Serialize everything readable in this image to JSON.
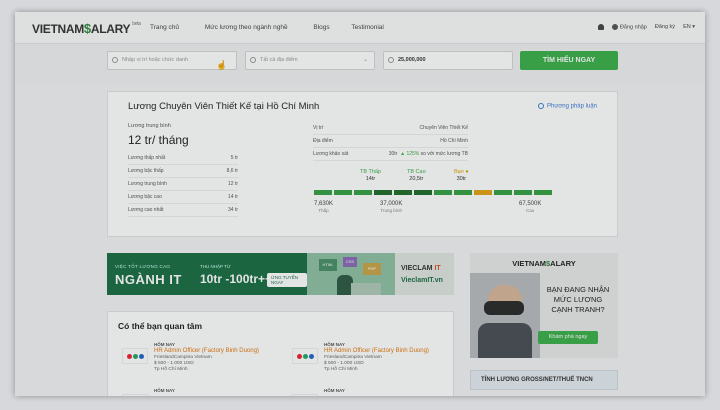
{
  "header": {
    "logo_main": "VIETNAM",
    "logo_dollar": "$",
    "logo_tail": "ALARY",
    "logo_beta": "beta",
    "nav": [
      "Trang chủ",
      "Mức lương theo ngành nghề",
      "Blogs",
      "Testimonial"
    ],
    "login": "Đăng nhập",
    "register": "Đăng ký",
    "lang": "EN ▾"
  },
  "search": {
    "position_placeholder": "Nhập vị trí hoặc chức danh",
    "location_placeholder": "Tất cả địa điểm",
    "salary_value": "25,000,000",
    "button": "TÌM HIỂU NGAY"
  },
  "result": {
    "title": "Lương Chuyên Viên Thiết Kế tại Hồ Chí Minh",
    "method_link": "Phương pháp luận",
    "avg_label": "Lương trung bình",
    "avg_value": "12 tr/ tháng",
    "stats": [
      {
        "label": "Lương thấp nhất",
        "value": "5 tr"
      },
      {
        "label": "Lương bậc thấp",
        "value": "8,6 tr"
      },
      {
        "label": "Lương trung bình",
        "value": "12 tr"
      },
      {
        "label": "Lương bậc cao",
        "value": "14 tr"
      },
      {
        "label": "Lương cao nhất",
        "value": "34 tr"
      }
    ],
    "info": [
      {
        "label": "Vị trí",
        "value": "Chuyên Viên Thiết Kế"
      },
      {
        "label": "Địa điểm",
        "value": "Hồ Chí Minh"
      }
    ],
    "survey_label": "Lương khảo sát",
    "survey_value": "30tr",
    "survey_pct": "▲ 125%",
    "survey_note": "so với mức lương TB",
    "gauge": {
      "low_label": "TB Thấp",
      "low_value": "14tr",
      "high_label": "TB Cao",
      "high_value": "20,5tr",
      "you_label": "Bạn ●",
      "you_value": "30tr",
      "you_level_percent": 73
    },
    "scale": [
      {
        "value": "7,630K",
        "label": "Thấp"
      },
      {
        "value": "37,000K",
        "label": "Trung bình"
      },
      {
        "value": "67,500K",
        "label": "Cao"
      }
    ]
  },
  "banner_it": {
    "tagline": "VIỆC TỐT LƯƠNG CAO",
    "big": "NGÀNH IT",
    "salary_label": "THU NHẬP TỪ",
    "salary": "10tr -100tr++",
    "apply": "ỨNG TUYỂN NGAY",
    "art_labels": [
      "HTML",
      "CSS",
      "PHP"
    ],
    "brand": "VIECLAM",
    "brand_accent": "IT",
    "url": "VieclamIT.vn"
  },
  "banner_vs": {
    "logo_main": "VIETNAM",
    "logo_dollar": "$",
    "logo_tail": "ALARY",
    "line1": "BẠN ĐANG NHẬN",
    "line2": "MỨC LƯƠNG",
    "line3": "CẠNH TRANH?",
    "button": "Khám phá ngay"
  },
  "interest": {
    "title": "Có thể bạn quan tâm",
    "jobs": [
      {
        "tag": "HÔM NAY",
        "title": "HR Admin Officer (Factory Binh Duong)",
        "company": "FrieslandCampina Vietnam",
        "salary": "$ 500 - 1.000 USD",
        "location": "Tp Hồ Chí Minh"
      },
      {
        "tag": "HÔM NAY",
        "title": "HR Admin Officer (Factory Binh Duong)",
        "company": "FrieslandCampina Vietnam",
        "salary": "$ 500 - 1.000 USD",
        "location": "Tp Hồ Chí Minh"
      },
      {
        "tag": "HÔM NAY",
        "title": "",
        "company": "",
        "salary": "",
        "location": ""
      },
      {
        "tag": "HÔM NAY",
        "title": "",
        "company": "",
        "salary": "",
        "location": ""
      }
    ]
  },
  "calc": {
    "title": "TÍNH LƯƠNG GROSS/NET/THUẾ TNCN"
  },
  "colors": {
    "primary_green": "#3bb04a",
    "dark_green": "#1f6e2c",
    "accent_gold": "#e3a418",
    "link_blue": "#3a7bd5",
    "job_orange": "#e07a10"
  }
}
